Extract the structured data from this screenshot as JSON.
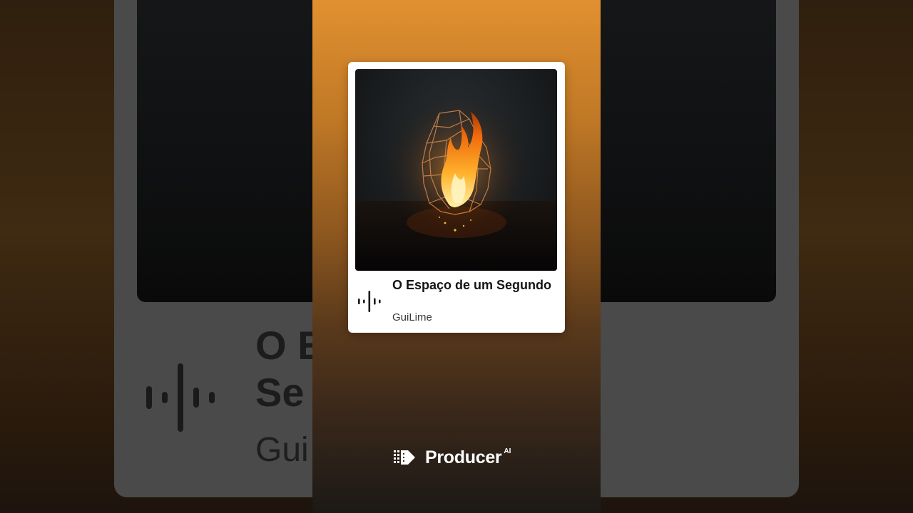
{
  "song": {
    "title": "O Espaço de um Segundo",
    "artist": "GuiLime"
  },
  "background_copy": {
    "title_line1": "O E",
    "title_line2": "Se",
    "artist": "Gui"
  },
  "brand": {
    "name": "Producer",
    "superscript": "AI"
  },
  "icons": {
    "waveform": "waveform-icon",
    "brand_logo": "producer-logo-icon",
    "cover_art": "burning-wire-cage-artwork"
  },
  "colors": {
    "panel_top": "#e19030",
    "panel_bottom": "#1c1916",
    "card": "#ffffff",
    "title_text": "#141414"
  }
}
